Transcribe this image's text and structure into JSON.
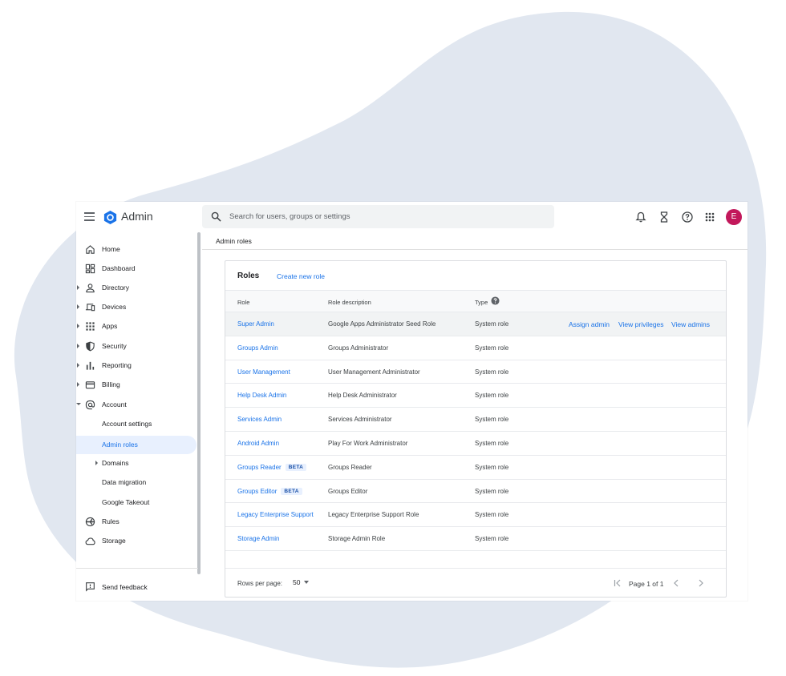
{
  "colors": {
    "accent": "#1a73e8",
    "avatar_bg": "#c2185b",
    "blob": "#e1e7f0",
    "active_bg": "#e8f0fe"
  },
  "header": {
    "app_name": "Admin",
    "search_placeholder": "Search for users, groups or settings",
    "avatar_letter": "E",
    "icons": [
      "menu-icon",
      "admin-logo-icon",
      "search-icon",
      "bell-icon",
      "hourglass-icon",
      "help-icon",
      "apps-grid-icon"
    ]
  },
  "sidebar": {
    "items": [
      {
        "label": "Home",
        "icon": "home-icon"
      },
      {
        "label": "Dashboard",
        "icon": "dashboard-icon"
      },
      {
        "label": "Directory",
        "icon": "person-icon"
      },
      {
        "label": "Devices",
        "icon": "devices-icon"
      },
      {
        "label": "Apps",
        "icon": "apps-grid-icon"
      },
      {
        "label": "Security",
        "icon": "shield-icon"
      },
      {
        "label": "Reporting",
        "icon": "bar-chart-icon"
      },
      {
        "label": "Billing",
        "icon": "credit-card-icon"
      },
      {
        "label": "Account",
        "icon": "at-sign-icon"
      },
      {
        "label": "Account settings"
      },
      {
        "label": "Admin roles"
      },
      {
        "label": "Domains"
      },
      {
        "label": "Data migration"
      },
      {
        "label": "Google Takeout"
      },
      {
        "label": "Rules",
        "icon": "rules-icon"
      },
      {
        "label": "Storage",
        "icon": "cloud-icon"
      }
    ],
    "feedback_label": "Send feedback"
  },
  "breadcrumb": "Admin roles",
  "card": {
    "title": "Roles",
    "create_label": "Create new role",
    "columns": {
      "role": "Role",
      "description": "Role description",
      "type": "Type"
    },
    "actions": {
      "assign": "Assign admin",
      "privileges": "View privileges",
      "admins": "View admins"
    },
    "rows": [
      {
        "role": "Super Admin",
        "description": "Google Apps Administrator Seed Role",
        "type": "System role",
        "beta": ""
      },
      {
        "role": "Groups Admin",
        "description": "Groups Administrator",
        "type": "System role",
        "beta": ""
      },
      {
        "role": "User Management",
        "description": "User Management Administrator",
        "type": "System role",
        "beta": ""
      },
      {
        "role": "Help Desk Admin",
        "description": "Help Desk Administrator",
        "type": "System role",
        "beta": ""
      },
      {
        "role": "Services Admin",
        "description": "Services Administrator",
        "type": "System role",
        "beta": ""
      },
      {
        "role": "Android Admin",
        "description": "Play For Work Administrator",
        "type": "System role",
        "beta": ""
      },
      {
        "role": "Groups Reader",
        "description": "Groups Reader",
        "type": "System role",
        "beta": "BETA"
      },
      {
        "role": "Groups Editor",
        "description": "Groups Editor",
        "type": "System role",
        "beta": "BETA"
      },
      {
        "role": "Legacy Enterprise Support",
        "description": "Legacy Enterprise Support Role",
        "type": "System role",
        "beta": ""
      },
      {
        "role": "Storage Admin",
        "description": "Storage Admin Role",
        "type": "System role",
        "beta": ""
      }
    ],
    "footer": {
      "rows_per_page_label": "Rows per page:",
      "rows_per_page_value": "50",
      "page_label": "Page 1 of 1"
    }
  }
}
